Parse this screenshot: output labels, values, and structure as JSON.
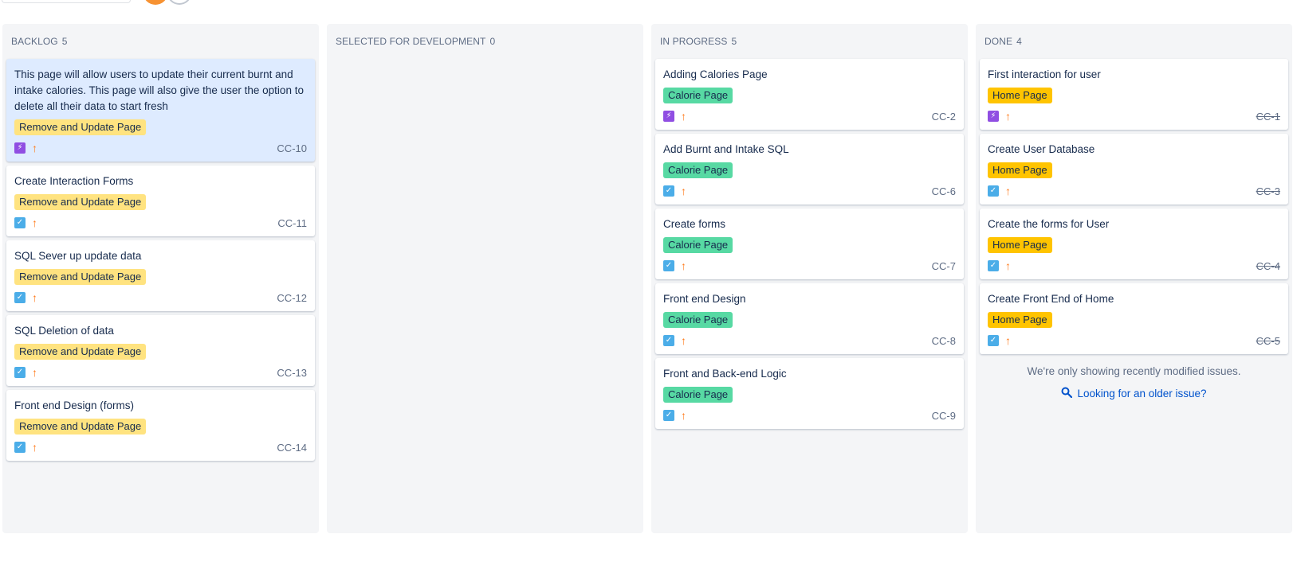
{
  "colors": {
    "column_bg": "#f4f5f7",
    "selected_card_bg": "#deebff",
    "epic_remove": "#ffe380",
    "epic_calorie": "#57d9a3",
    "epic_home": "#ffc400",
    "task_icon": "#4bade8",
    "subtask_icon": "#904ee2",
    "priority_high": "#ff7a1a",
    "link": "#0052cc"
  },
  "columns": [
    {
      "name": "BACKLOG",
      "count": "5",
      "cards": [
        {
          "title": "This page will allow users to update their current burnt and intake calories. This page will also give the user the option to delete all their data to start fresh",
          "epic": "Remove and Update Page",
          "type_icon": "lightning-icon",
          "priority_icon": "arrow-up-icon",
          "key": "CC-10"
        },
        {
          "title": "Create Interaction Forms",
          "epic": "Remove and Update Page",
          "type_icon": "checkbox-icon",
          "priority_icon": "arrow-up-icon",
          "key": "CC-11"
        },
        {
          "title": "SQL Sever up update data",
          "epic": "Remove and Update Page",
          "type_icon": "checkbox-icon",
          "priority_icon": "arrow-up-icon",
          "key": "CC-12"
        },
        {
          "title": "SQL Deletion of data",
          "epic": "Remove and Update Page",
          "type_icon": "checkbox-icon",
          "priority_icon": "arrow-up-icon",
          "key": "CC-13"
        },
        {
          "title": "Front end Design (forms)",
          "epic": "Remove and Update Page",
          "type_icon": "checkbox-icon",
          "priority_icon": "arrow-up-icon",
          "key": "CC-14"
        }
      ]
    },
    {
      "name": "SELECTED FOR DEVELOPMENT",
      "count": "0",
      "cards": []
    },
    {
      "name": "IN PROGRESS",
      "count": "5",
      "cards": [
        {
          "title": "Adding Calories Page",
          "epic": "Calorie Page",
          "type_icon": "lightning-icon",
          "priority_icon": "arrow-up-icon",
          "key": "CC-2"
        },
        {
          "title": "Add Burnt and Intake SQL",
          "epic": "Calorie Page",
          "type_icon": "checkbox-icon",
          "priority_icon": "arrow-up-icon",
          "key": "CC-6"
        },
        {
          "title": "Create forms",
          "epic": "Calorie Page",
          "type_icon": "checkbox-icon",
          "priority_icon": "arrow-up-icon",
          "key": "CC-7"
        },
        {
          "title": "Front end Design",
          "epic": "Calorie Page",
          "type_icon": "checkbox-icon",
          "priority_icon": "arrow-up-icon",
          "key": "CC-8"
        },
        {
          "title": "Front and Back-end Logic",
          "epic": "Calorie Page",
          "type_icon": "checkbox-icon",
          "priority_icon": "arrow-up-icon",
          "key": "CC-9"
        }
      ]
    },
    {
      "name": "DONE",
      "count": "4",
      "cards": [
        {
          "title": "First interaction for user",
          "epic": "Home Page",
          "type_icon": "lightning-icon",
          "priority_icon": "arrow-up-icon",
          "key": "CC-1"
        },
        {
          "title": "Create User Database",
          "epic": "Home Page",
          "type_icon": "checkbox-icon",
          "priority_icon": "arrow-up-icon",
          "key": "CC-3"
        },
        {
          "title": "Create the forms for User",
          "epic": "Home Page",
          "type_icon": "checkbox-icon",
          "priority_icon": "arrow-up-icon",
          "key": "CC-4"
        },
        {
          "title": "Create Front End of Home",
          "epic": "Home Page",
          "type_icon": "checkbox-icon",
          "priority_icon": "arrow-up-icon",
          "key": "CC-5"
        }
      ],
      "note": "We're only showing recently modified issues.",
      "older_link": "Looking for an older issue?"
    }
  ]
}
